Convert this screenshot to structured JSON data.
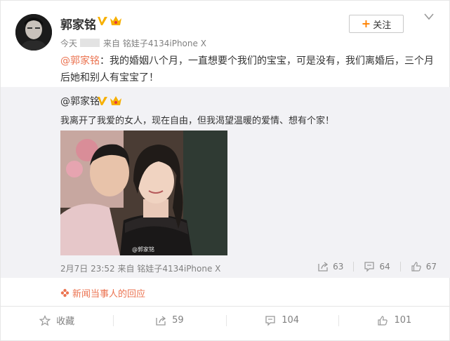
{
  "post": {
    "user_name": "郭家铭",
    "time": "今天",
    "source": "来自 铭娃子4134iPhone X",
    "follow_label": "关注",
    "mention": "@郭家铭",
    "text": "：我的婚姻八个月，一直想要个我们的宝宝，可是没有，我们离婚后，三个月后她和别人有宝宝了！"
  },
  "repost": {
    "user": "@郭家铭",
    "text": "我离开了我爱的女人，现在自由，但我渴望温暖的爱情、想有个家！",
    "watermark": "@郭家铭",
    "time": "2月7日 23:52",
    "source": "来自 铭娃子4134iPhone X",
    "shares": "63",
    "comments": "64",
    "likes": "67"
  },
  "event_source": "新闻当事人的回应",
  "actions": {
    "favorite": "收藏",
    "share": "59",
    "comment": "104",
    "like": "101"
  },
  "colors": {
    "accent": "#eb7350",
    "follow_plus": "#ff8200",
    "repost_bg": "#f2f2f5",
    "muted": "#808080"
  },
  "icons": [
    "v-verified-icon",
    "crown-icon",
    "chevron-down-icon",
    "share-icon",
    "comment-icon",
    "like-icon",
    "star-icon",
    "flower-icon"
  ]
}
